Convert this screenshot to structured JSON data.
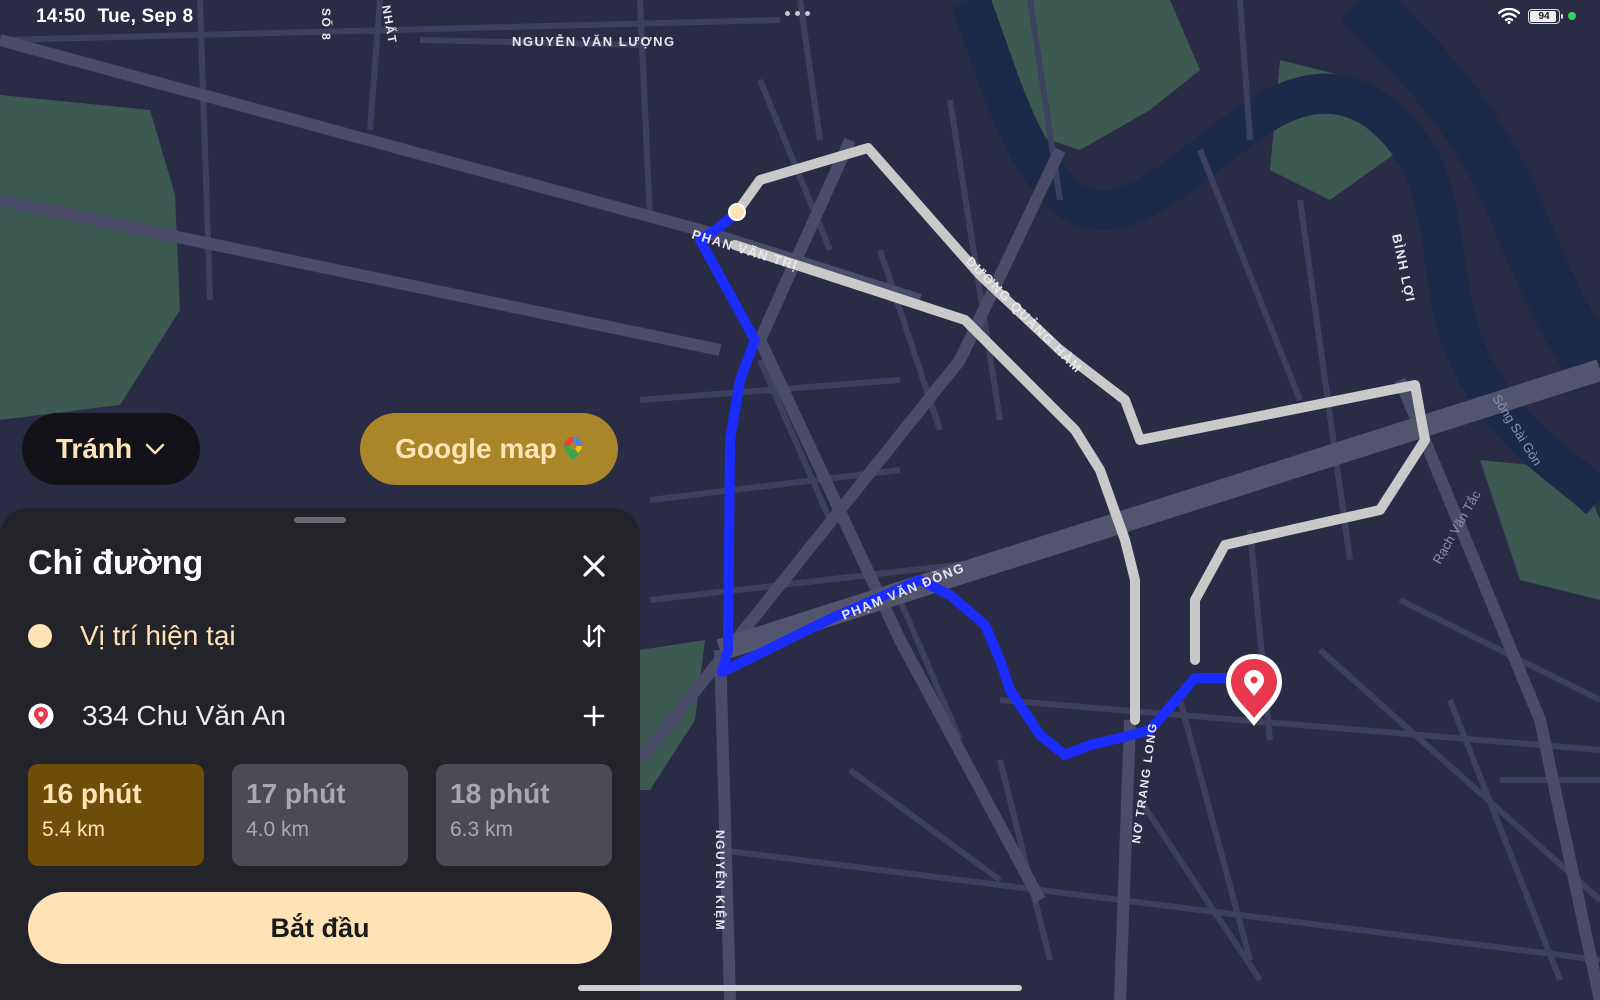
{
  "status_bar": {
    "time": "14:50",
    "date": "Tue, Sep 8",
    "battery": "94"
  },
  "map": {
    "streets": {
      "nguyen_van_luong": "NGUYỄN VĂN LƯỢNG",
      "phan_van_tri": "PHAN VĂN TRỊ",
      "duong_quang_ham": "DƯƠNG QUẢNG HÀM",
      "binh_loi": "BÌNH LỢI",
      "pham_van_dong": "PHẠM VĂN ĐỒNG",
      "no_trang_long": "NƠ TRANG LONG",
      "nguyen_kiem": "NGUYỄN KIỆM",
      "so_8": "SỐ 8",
      "nhat": "NHẤT",
      "song_sai_gon": "Sông Sài Gòn",
      "rach_van_tac": "Rạch Văn Tắc"
    },
    "colors": {
      "route_primary": "#1a2cff",
      "route_alt": "#c9c9c9",
      "destination": "#e8384f"
    }
  },
  "controls": {
    "avoid_label": "Tránh",
    "google_map_label": "Google map"
  },
  "directions": {
    "title": "Chỉ đường",
    "origin": "Vị trí hiện tại",
    "destination": "334 Chu Văn An",
    "routes": [
      {
        "time": "16 phút",
        "distance": "5.4 km",
        "selected": true
      },
      {
        "time": "17 phút",
        "distance": "4.0 km",
        "selected": false
      },
      {
        "time": "18 phút",
        "distance": "6.3 km",
        "selected": false
      }
    ],
    "start_label": "Bắt đầu"
  },
  "colors": {
    "accent": "#fde3b6",
    "selected_route": "#6e4d08",
    "google_button": "#a9862a"
  }
}
